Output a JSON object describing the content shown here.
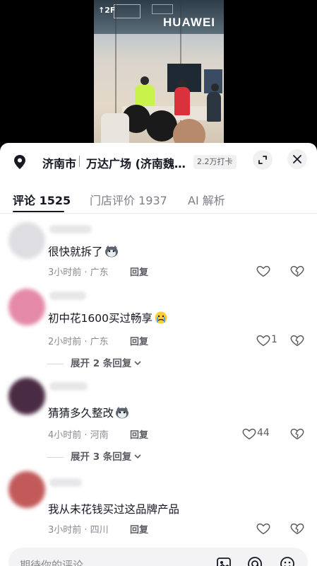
{
  "video": {
    "floor_label": "↑2F",
    "brand": "HUAWEI"
  },
  "location": {
    "city": "济南市",
    "place": "万达广场 (济南魏…",
    "checkins": "2.2万打卡"
  },
  "tabs": [
    {
      "label": "评论 1525",
      "active": true
    },
    {
      "label": "门店评价 1937",
      "active": false
    },
    {
      "label": "AI 解析",
      "active": false
    }
  ],
  "comments": [
    {
      "text": "很快就拆了",
      "emoji": "husky-emoji",
      "time": "3小时前",
      "region": "广东",
      "meta": "3小时前 · 广东",
      "reply_label": "回复",
      "likes": "",
      "expand": "",
      "avatar_color": "#d9d9dc"
    },
    {
      "text": "初中花1600买过畅享",
      "emoji": "crying-emoji",
      "time": "2小时前",
      "region": "广东",
      "meta": "2小时前 · 广东",
      "reply_label": "回复",
      "likes": "1",
      "expand": "展开 2 条回复",
      "avatar_color": "#e48aa8"
    },
    {
      "text": "猜猜多久整改",
      "emoji": "husky-emoji",
      "time": "4小时前",
      "region": "河南",
      "meta": "4小时前 · 河南",
      "reply_label": "回复",
      "likes": "44",
      "expand": "展开 3 条回复",
      "avatar_color": "#4a2b44"
    },
    {
      "text": "我从未花钱买过这品牌产品",
      "emoji": "",
      "time": "3小时前",
      "region": "四川",
      "meta": "3小时前 · 四川",
      "reply_label": "回复",
      "likes": "",
      "expand": "",
      "avatar_color": "#c25a5a"
    }
  ],
  "input": {
    "placeholder": "期待你的评论"
  },
  "icons": [
    "location-pin-icon",
    "expand-icon",
    "close-icon",
    "heart-icon",
    "broken-heart-icon",
    "chevron-down-icon",
    "image-icon",
    "at-icon",
    "emoji-icon"
  ]
}
